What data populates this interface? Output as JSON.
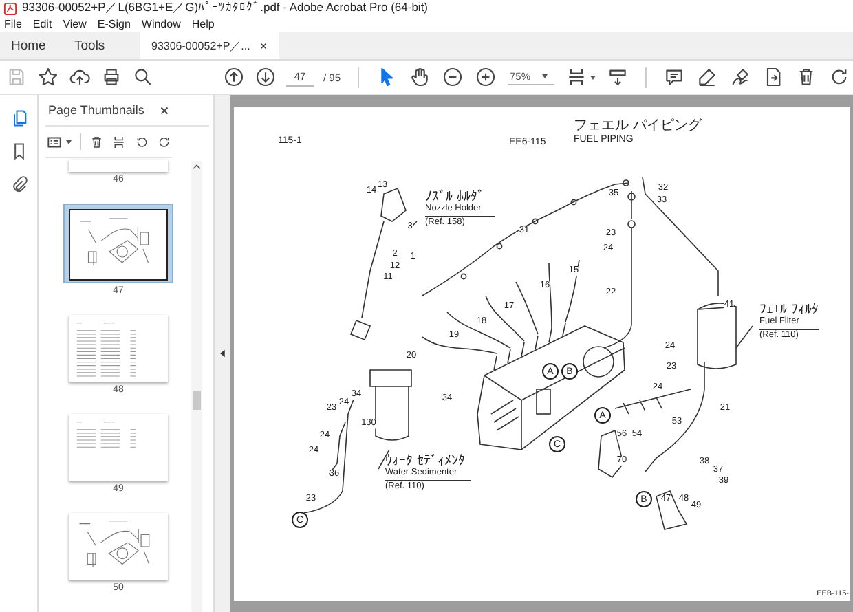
{
  "window": {
    "title": "93306-00052+P／L(6BG1+E／G)ﾊﾟｰﾂｶﾀﾛｸﾞ.pdf - Adobe Acrobat Pro (64-bit)"
  },
  "menu": [
    "File",
    "Edit",
    "View",
    "E-Sign",
    "Window",
    "Help"
  ],
  "tabs": [
    {
      "label": "Home",
      "selected": false,
      "kind": "nav"
    },
    {
      "label": "Tools",
      "selected": false,
      "kind": "nav"
    },
    {
      "label": "93306-00052+P／...",
      "selected": true,
      "kind": "document"
    }
  ],
  "toolbar": {
    "file_tools": [
      {
        "kind": "save",
        "disabled": true
      },
      {
        "kind": "star",
        "disabled": false
      },
      {
        "kind": "upload",
        "disabled": false
      },
      {
        "kind": "print",
        "disabled": false
      },
      {
        "kind": "search",
        "disabled": false
      }
    ],
    "page_field": {
      "value": "47"
    },
    "page_total": "/ 95",
    "mode_tools": [
      {
        "kind": "select",
        "selected": true
      },
      {
        "kind": "hand",
        "selected": false
      }
    ],
    "zoom": {
      "value": "75%"
    }
  },
  "sidebar": {
    "rail": [
      {
        "kind": "pages",
        "selected": true
      },
      {
        "kind": "bookmarks",
        "selected": false
      },
      {
        "kind": "attachments",
        "selected": false
      }
    ],
    "panel_title": "Page Thumbnails",
    "thumbnails": [
      {
        "label": "46",
        "selected": false,
        "kind": "partial"
      },
      {
        "label": "47",
        "selected": true,
        "kind": "diagram"
      },
      {
        "label": "48",
        "selected": false,
        "kind": "list"
      },
      {
        "label": "49",
        "selected": false,
        "kind": "short-list"
      },
      {
        "label": "50",
        "selected": false,
        "kind": "diagram"
      }
    ]
  },
  "document": {
    "section": "115-1",
    "code": "EE6-115",
    "title_kana": "フェエル パイピング",
    "title": "FUEL PIPING",
    "footer": "EEB-115-",
    "references": [
      {
        "kana": "ﾉｽﾞﾙ ﾎﾙﾀﾞ",
        "name": "Nozzle Holder",
        "ref": "(Ref. 158)"
      },
      {
        "kana": "ﾌｪｴﾙ ﾌｨﾙﾀ",
        "name": "Fuel Filter",
        "ref": "(Ref. 110)"
      },
      {
        "kana": "ｳｫｰﾀ ｾﾃﾞｨﾒﾝﾀ",
        "name": "Water Sedimenter",
        "ref": "(Ref. 110)"
      }
    ],
    "callouts": [
      {
        "text": "13",
        "kind": "number"
      },
      {
        "text": "14",
        "kind": "number"
      },
      {
        "text": "3",
        "kind": "number"
      },
      {
        "text": "2",
        "kind": "number"
      },
      {
        "text": "1",
        "kind": "number"
      },
      {
        "text": "12",
        "kind": "number"
      },
      {
        "text": "11",
        "kind": "number"
      },
      {
        "text": "35",
        "kind": "number"
      },
      {
        "text": "32",
        "kind": "number"
      },
      {
        "text": "33",
        "kind": "number"
      },
      {
        "text": "31",
        "kind": "number"
      },
      {
        "text": "23",
        "kind": "number"
      },
      {
        "text": "24",
        "kind": "number"
      },
      {
        "text": "15",
        "kind": "number"
      },
      {
        "text": "16",
        "kind": "number"
      },
      {
        "text": "22",
        "kind": "number"
      },
      {
        "text": "17",
        "kind": "number"
      },
      {
        "text": "18",
        "kind": "number"
      },
      {
        "text": "19",
        "kind": "number"
      },
      {
        "text": "20",
        "kind": "number"
      },
      {
        "text": "41",
        "kind": "number"
      },
      {
        "text": "24",
        "kind": "number"
      },
      {
        "text": "23",
        "kind": "number"
      },
      {
        "text": "24",
        "kind": "number"
      },
      {
        "text": "34",
        "kind": "number"
      },
      {
        "text": "A",
        "kind": "circled"
      },
      {
        "text": "B",
        "kind": "circled"
      },
      {
        "text": "21",
        "kind": "number"
      },
      {
        "text": "A",
        "kind": "circled"
      },
      {
        "text": "53",
        "kind": "number"
      },
      {
        "text": "56",
        "kind": "number"
      },
      {
        "text": "54",
        "kind": "number"
      },
      {
        "text": "C",
        "kind": "circled"
      },
      {
        "text": "34",
        "kind": "number"
      },
      {
        "text": "24",
        "kind": "number"
      },
      {
        "text": "23",
        "kind": "number"
      },
      {
        "text": "130",
        "kind": "number"
      },
      {
        "text": "24",
        "kind": "number"
      },
      {
        "text": "24",
        "kind": "number"
      },
      {
        "text": "36",
        "kind": "number"
      },
      {
        "text": "23",
        "kind": "number"
      },
      {
        "text": "C",
        "kind": "circled"
      },
      {
        "text": "70",
        "kind": "number"
      },
      {
        "text": "38",
        "kind": "number"
      },
      {
        "text": "37",
        "kind": "number"
      },
      {
        "text": "39",
        "kind": "number"
      },
      {
        "text": "B",
        "kind": "circled"
      },
      {
        "text": "47",
        "kind": "number"
      },
      {
        "text": "48",
        "kind": "number"
      },
      {
        "text": "49",
        "kind": "number"
      }
    ]
  }
}
